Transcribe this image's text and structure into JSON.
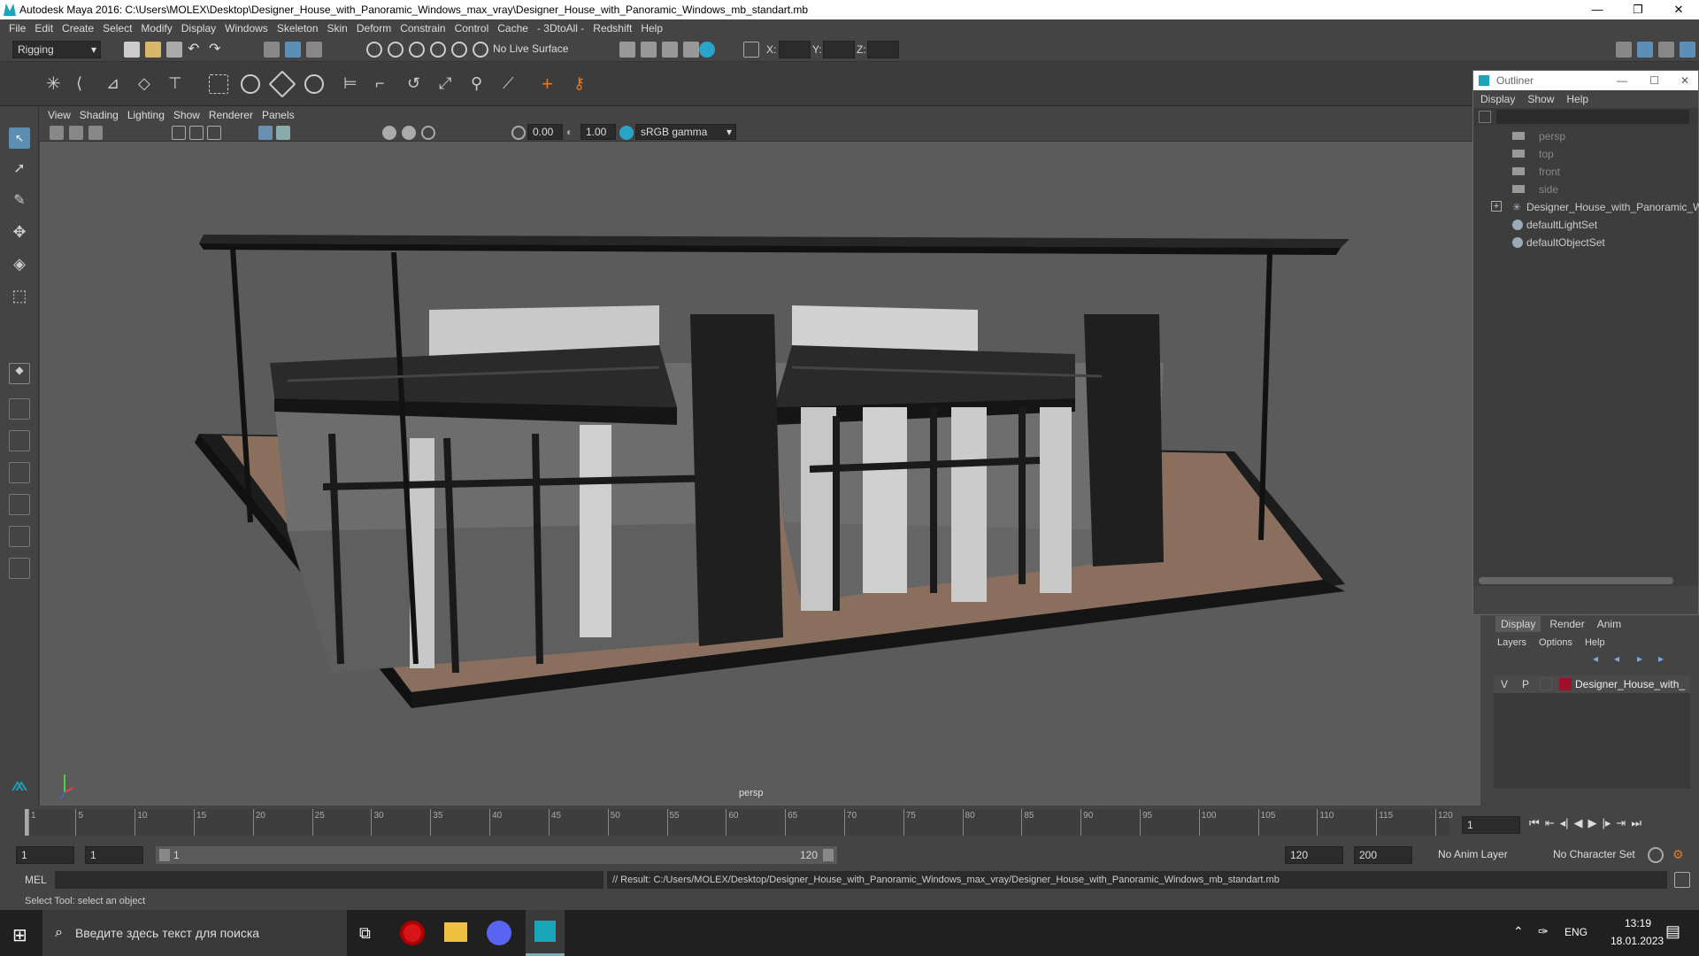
{
  "titlebar": {
    "title": "Autodesk Maya 2016: C:\\Users\\MOLEX\\Desktop\\Designer_House_with_Panoramic_Windows_max_vray\\Designer_House_with_Panoramic_Windows_mb_standart.mb"
  },
  "menubar": {
    "items": [
      "File",
      "Edit",
      "Create",
      "Select",
      "Modify",
      "Display",
      "Windows",
      "Skeleton",
      "Skin",
      "Deform",
      "Constrain",
      "Control",
      "Cache",
      "- 3DtoAll -",
      "Redshift",
      "Help"
    ]
  },
  "statusline": {
    "menuset": "Rigging",
    "live_surface": "No Live Surface",
    "x_label": "X:",
    "y_label": "Y:",
    "z_label": "Z:"
  },
  "viewport": {
    "menu": [
      "View",
      "Shading",
      "Lighting",
      "Show",
      "Renderer",
      "Panels"
    ],
    "near_value": "0.00",
    "far_value": "1.00",
    "color_space": "sRGB gamma",
    "camera_label": "persp"
  },
  "outliner": {
    "title": "Outliner",
    "menu": [
      "Display",
      "Show",
      "Help"
    ],
    "items": [
      {
        "label": "persp",
        "dim": true
      },
      {
        "label": "top",
        "dim": true
      },
      {
        "label": "front",
        "dim": true
      },
      {
        "label": "side",
        "dim": true
      },
      {
        "label": "Designer_House_with_Panoramic_W",
        "dim": false
      },
      {
        "label": "defaultLightSet",
        "dim": false
      },
      {
        "label": "defaultObjectSet",
        "dim": false
      }
    ]
  },
  "layers": {
    "tabs": [
      "Display",
      "Render",
      "Anim"
    ],
    "menu": [
      "Layers",
      "Options",
      "Help"
    ],
    "row": {
      "v": "V",
      "p": "P",
      "name": "Designer_House_with_",
      "color": "#a0102a"
    }
  },
  "timeline": {
    "ticks": [
      "1",
      "5",
      "10",
      "15",
      "20",
      "25",
      "30",
      "35",
      "40",
      "45",
      "50",
      "55",
      "60",
      "65",
      "70",
      "75",
      "80",
      "85",
      "90",
      "95",
      "100",
      "105",
      "110",
      "115",
      "120"
    ],
    "current_frame": "1"
  },
  "range": {
    "start": "1",
    "playback_start": "1",
    "slider_start": "1",
    "slider_end": "120",
    "playback_end": "120",
    "end": "200",
    "anim_layer": "No Anim Layer",
    "char_set": "No Character Set"
  },
  "cmdline": {
    "lang": "MEL",
    "result": "// Result: C:/Users/MOLEX/Desktop/Designer_House_with_Panoramic_Windows_max_vray/Designer_House_with_Panoramic_Windows_mb_standart.mb"
  },
  "helpline": {
    "text": "Select Tool: select an object"
  },
  "taskbar": {
    "search_placeholder": "Введите здесь текст для поиска",
    "lang": "ENG",
    "time": "13:19",
    "date": "18.01.2023"
  }
}
